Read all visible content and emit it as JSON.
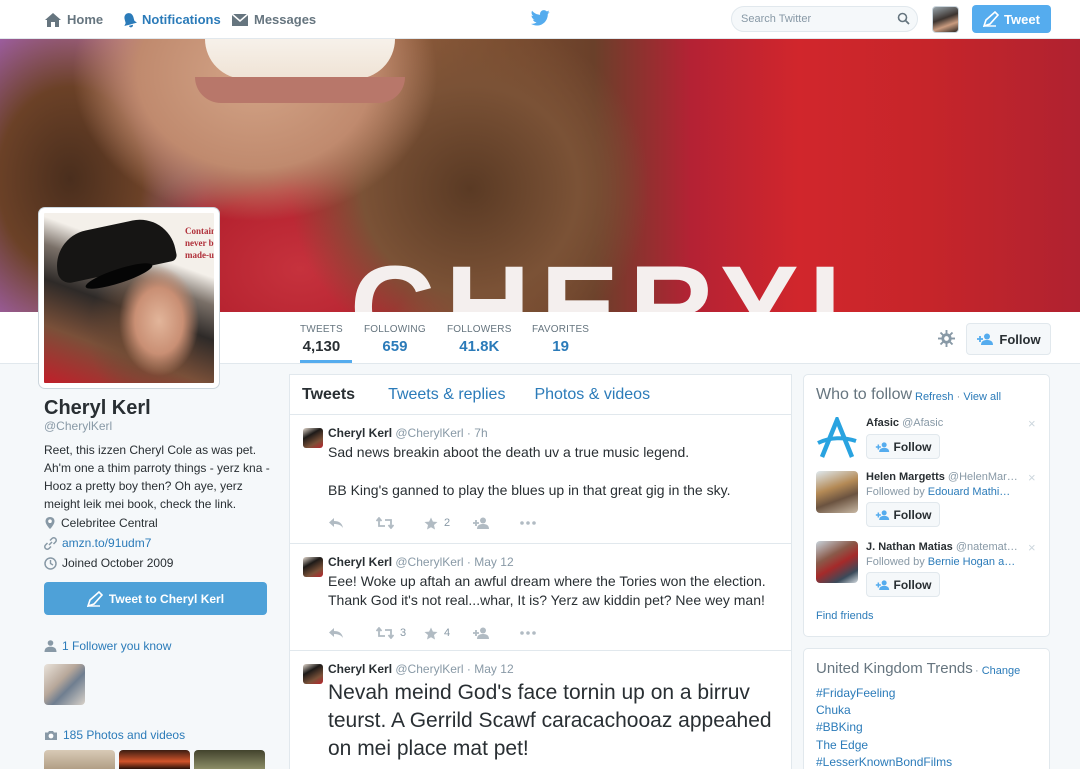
{
  "topnav": {
    "home": "Home",
    "notifications": "Notifications",
    "messages": "Messages",
    "search_placeholder": "Search Twitter",
    "tweet_button": "Tweet"
  },
  "banner": {
    "text": "CHERYL"
  },
  "stats": [
    {
      "label": "TWEETS",
      "value": "4,130"
    },
    {
      "label": "FOLLOWING",
      "value": "659"
    },
    {
      "label": "FOLLOWERS",
      "value": "41.8K"
    },
    {
      "label": "FAVORITES",
      "value": "19"
    }
  ],
  "avatar_overlay": [
    "Contain",
    "never b",
    "made-u"
  ],
  "follow_button": "Follow",
  "profile": {
    "name": "Cheryl Kerl",
    "handle": "@CherylKerl",
    "bio": "Reet, this izzen Cheryl Cole as was pet. Ah'm one a thim parroty things - yerz kna - Hooz a pretty boy then? Oh aye, yerz meight leik mei book, check the link.",
    "location": "Celebritee Central",
    "url": "amzn.to/91udm7",
    "joined": "Joined October 2009",
    "tweet_to": "Tweet to Cheryl Kerl",
    "followers_you_know": "1 Follower you know",
    "photos_videos": "185 Photos and videos"
  },
  "timeline": {
    "tabs": [
      "Tweets",
      "Tweets & replies",
      "Photos & videos"
    ],
    "tweets": [
      {
        "name": "Cheryl Kerl",
        "handle": "@CherylKerl",
        "time": "7h",
        "text1": "Sad news breakin aboot the death uv a true music legend.",
        "text2": "BB King's ganned to play the blues up in that great gig in the sky.",
        "retweets": "",
        "favorites": "2"
      },
      {
        "name": "Cheryl Kerl",
        "handle": "@CherylKerl",
        "time": "May 12",
        "text1": "Eee! Woke up aftah an awful dream where the Tories won the election. Thank God it's not real...whar, It is? Yerz aw kiddin pet? Nee wey man!",
        "retweets": "3",
        "favorites": "4"
      },
      {
        "name": "Cheryl Kerl",
        "handle": "@CherylKerl",
        "time": "May 12",
        "text1": "Nevah meind God's face tornin up on a birruv teurst. A Gerrild Scawf caracachooaz appeahed on mei place mat pet!"
      }
    ]
  },
  "who_to_follow": {
    "title": "Who to follow",
    "refresh": "Refresh",
    "view_all": "View all",
    "separator": "·",
    "follow_label": "Follow",
    "close": "×",
    "find_friends": "Find friends",
    "suggestions": [
      {
        "name": "Afasic",
        "handle": "@Afasic",
        "followed_prefix": "",
        "followed_by": ""
      },
      {
        "name": "Helen Margetts",
        "handle": "@HelenMar…",
        "followed_prefix": "Followed by",
        "followed_by": "Edouard Mathi…"
      },
      {
        "name": "J. Nathan Matias",
        "handle": "@natemat…",
        "followed_prefix": "Followed by",
        "followed_by": "Bernie Hogan a…"
      }
    ]
  },
  "trends": {
    "title": "United Kingdom Trends",
    "change": "Change",
    "separator": "·",
    "items": [
      "#FridayFeeling",
      "Chuka",
      "#BBKing",
      "The Edge",
      "#LesserKnownBondFilms"
    ]
  },
  "colors": {
    "accent": "#55acee",
    "link": "#2b7bb9",
    "text": "#292f33",
    "muted": "#8899a6",
    "background": "#f5f8fa"
  }
}
